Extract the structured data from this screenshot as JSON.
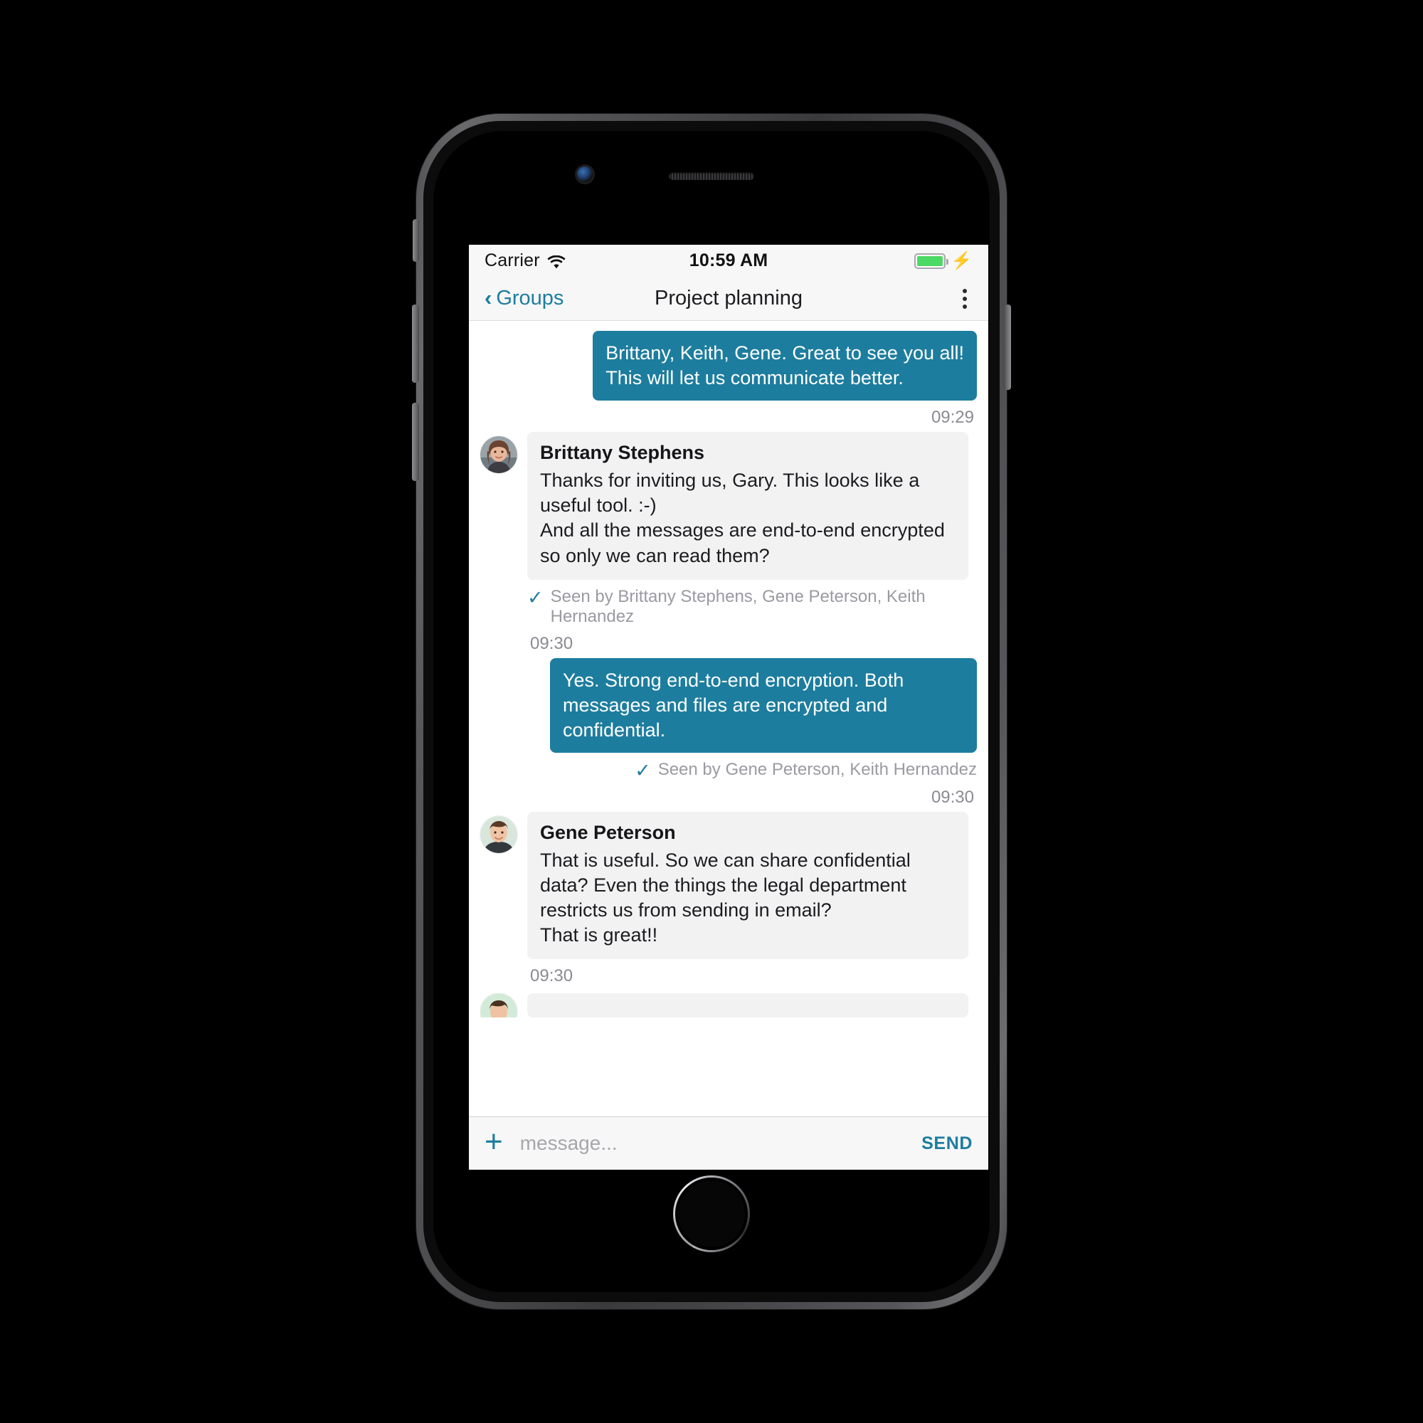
{
  "status_bar": {
    "carrier": "Carrier",
    "wifi_icon": "wifi-icon",
    "time": "10:59 AM",
    "battery_icon": "battery-icon",
    "battery_level_percent": 100,
    "charging_icon": "lightning-bolt-icon"
  },
  "nav_bar": {
    "back_label": "Groups",
    "back_icon": "chevron-left-icon",
    "title": "Project planning",
    "more_icon": "overflow-menu-icon"
  },
  "colors": {
    "accent": "#1d7d9e",
    "outgoing_bubble": "#1d7d9e",
    "incoming_bubble": "#f2f2f3",
    "battery_green": "#4cd964",
    "muted_text": "#8a8a92"
  },
  "messages": [
    {
      "id": "m1",
      "direction": "outgoing",
      "text": "Brittany, Keith, Gene. Great to see you all!\nThis will let us communicate better.",
      "time": "09:29",
      "seen_by": null
    },
    {
      "id": "m2",
      "direction": "incoming",
      "sender": "Brittany Stephens",
      "avatar": "avatar-brittany",
      "text": "Thanks for inviting us, Gary. This looks like a useful tool. :-)\nAnd all the messages are end-to-end encrypted so only we can read them?",
      "seen_by": "Seen by Brittany Stephens, Gene Peterson, Keith Hernandez",
      "time": "09:30"
    },
    {
      "id": "m3",
      "direction": "outgoing",
      "text": "Yes. Strong end-to-end encryption. Both messages and files are encrypted and confidential.",
      "seen_by": "Seen by Gene Peterson, Keith Hernandez",
      "time": "09:30"
    },
    {
      "id": "m4",
      "direction": "incoming",
      "sender": "Gene Peterson",
      "avatar": "avatar-gene",
      "text": "That is useful. So we can share confidential data? Even the things the legal department restricts us from sending in email?\nThat is great!!",
      "seen_by": null,
      "time": "09:30"
    }
  ],
  "composer": {
    "attach_icon": "plus-icon",
    "input_value": "",
    "placeholder": "message...",
    "send_label": "SEND"
  },
  "device": {
    "camera_icon": "front-camera-icon",
    "earpiece_icon": "earpiece-speaker-icon",
    "home_button_icon": "home-button-icon"
  }
}
